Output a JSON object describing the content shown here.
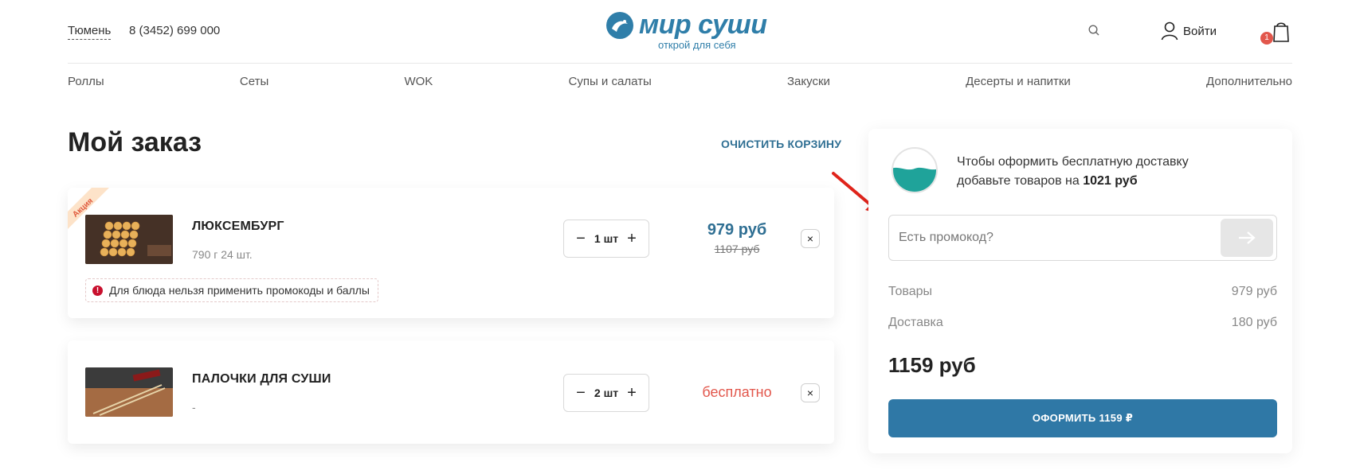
{
  "header": {
    "city": "Тюмень",
    "phone": "8 (3452) 699 000",
    "logo_title": "мир суши",
    "logo_subtitle": "открой для себя",
    "login_label": "Войти",
    "cart_count": "1",
    "icons": [
      "search-icon",
      "user-icon",
      "cart-icon"
    ]
  },
  "nav": {
    "items": [
      {
        "label": "Роллы"
      },
      {
        "label": "Сеты"
      },
      {
        "label": "WOK"
      },
      {
        "label": "Супы и салаты"
      },
      {
        "label": "Закуски"
      },
      {
        "label": "Десерты и напитки"
      },
      {
        "label": "Дополнительно"
      }
    ]
  },
  "order": {
    "title": "Мой заказ",
    "clear_cart": "ОЧИСТИТЬ КОРЗИНУ",
    "items": [
      {
        "badge": "Акция",
        "name": "ЛЮКСЕМБУРГ",
        "meta": "790 г 24 шт.",
        "qty": "1 шт",
        "price": "979 руб",
        "old_price": "1107 руб",
        "warning": "Для блюда нельзя применить промокоды и баллы",
        "remove": "×"
      },
      {
        "name": "ПАЛОЧКИ ДЛЯ СУШИ",
        "meta": "-",
        "qty": "2 шт",
        "price": "бесплатно",
        "remove": "×"
      }
    ],
    "qty_minus": "−",
    "qty_plus": "+"
  },
  "summary": {
    "delivery_text": "Чтобы оформить бесплатную доставку добавьте товаров на",
    "delivery_amount": "1021 руб",
    "promo_placeholder": "Есть промокод?",
    "goods_label": "Товары",
    "goods_value": "979 руб",
    "delivery_label": "Доставка",
    "delivery_value": "180 руб",
    "total": "1159 руб",
    "checkout_label": "ОФОРМИТЬ 1159 ₽"
  },
  "colors": {
    "brand": "#2f7ea9",
    "accent_button": "#2f78a6",
    "price": "#2f6f93",
    "free": "#e2574c",
    "warning": "#c8102e",
    "annotation_arrow": "#e0241b"
  }
}
